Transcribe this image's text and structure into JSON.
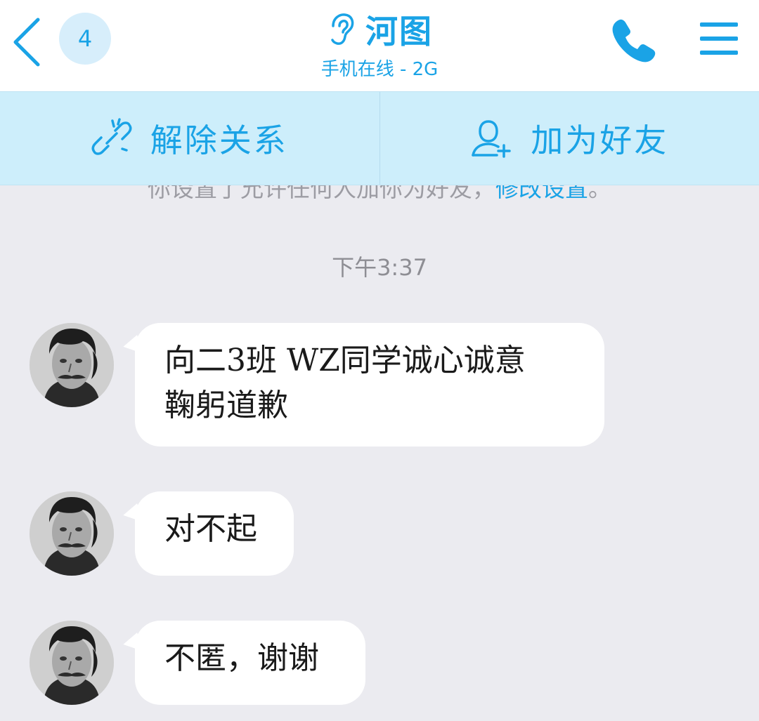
{
  "header": {
    "unread_count": "4",
    "contact_name": "河图",
    "contact_status": "手机在线 - 2G",
    "icons": {
      "back": "chevron-left-icon",
      "listen": "ear-icon",
      "call": "phone-icon",
      "menu": "hamburger-menu-icon"
    }
  },
  "action_bar": {
    "remove_label": "解除关系",
    "add_friend_label": "加为好友",
    "icons": {
      "remove": "broken-link-icon",
      "add_friend": "add-user-icon"
    }
  },
  "chat": {
    "notice_text": "你设置了允许任何人加你为好友，",
    "notice_link": "修改设置",
    "notice_end": "。",
    "timestamp": "下午3:37",
    "messages": [
      {
        "text": "向二3班 WZ同学诚心诚意 鞠躬道歉"
      },
      {
        "text": "对不起"
      },
      {
        "text": "不匿，谢谢"
      }
    ]
  },
  "colors": {
    "accent": "#1aa3e6",
    "action_bar_bg": "#cdeefb",
    "chat_bg": "#ebebf0",
    "bubble_bg": "#ffffff"
  }
}
